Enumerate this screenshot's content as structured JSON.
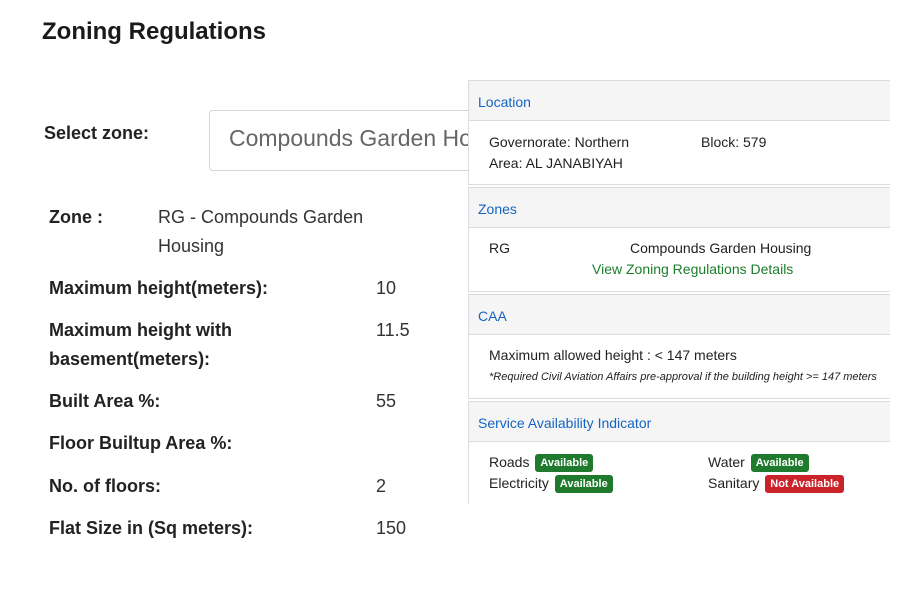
{
  "page": {
    "title": "Zoning Regulations"
  },
  "selector": {
    "label": "Select zone:",
    "value": "Compounds Garden Housing"
  },
  "rules": [
    {
      "label": "Zone :",
      "value": "RG - Compounds Garden Housing"
    },
    {
      "label": "Maximum height(meters):",
      "value": "10"
    },
    {
      "label": "Maximum height with basement(meters):",
      "value": "11.5"
    },
    {
      "label": "Built Area %:",
      "value": "55"
    },
    {
      "label": "Floor Builtup Area %:",
      "value": ""
    },
    {
      "label": "No. of floors:",
      "value": "2"
    },
    {
      "label": "Flat Size in (Sq meters):",
      "value": "150"
    }
  ],
  "info_panel": {
    "location": {
      "heading": "Location",
      "governorate": "Governorate: Northern",
      "block": "Block: 579",
      "area": "Area: AL JANABIYAH"
    },
    "zones": {
      "heading": "Zones",
      "code": "RG",
      "name": "Compounds Garden Housing",
      "link": "View Zoning Regulations Details"
    },
    "caa": {
      "heading": "CAA",
      "max_height": "Maximum allowed height : < 147 meters",
      "note": "*Required Civil Aviation Affairs pre-approval if the building height >= 147 meters"
    },
    "services": {
      "heading": "Service Availability Indicator",
      "items": [
        {
          "name": "Roads",
          "status": "Available"
        },
        {
          "name": "Water",
          "status": "Available"
        },
        {
          "name": "Electricity",
          "status": "Available"
        },
        {
          "name": "Sanitary",
          "status": "Not Available"
        }
      ],
      "colors": {
        "available": "#1f7a2e",
        "not_available": "#cc2229"
      }
    }
  }
}
